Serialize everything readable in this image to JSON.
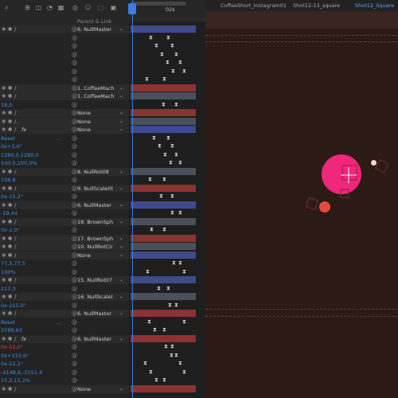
{
  "time_ruler": {
    "marker": "02s"
  },
  "column_header": {
    "parent_link": "Parent & Link"
  },
  "composition_tabs": [
    {
      "label": "CoffeeShort_Instagram01"
    },
    {
      "label": "Shot12-13_square"
    },
    {
      "label": "Shot12_Square"
    }
  ],
  "rows": [
    {
      "kind": "layer",
      "name": "6. NullMaster",
      "dd": "⌄"
    },
    {
      "kind": "spiral"
    },
    {
      "kind": "spiral"
    },
    {
      "kind": "spiral"
    },
    {
      "kind": "spiral"
    },
    {
      "kind": "spiral"
    },
    {
      "kind": "spiral"
    },
    {
      "kind": "layer",
      "name": "1. CoffeeMach",
      "dd": "⌄"
    },
    {
      "kind": "layer",
      "name": "1. CoffeeMach",
      "dd": "⌄"
    },
    {
      "kind": "value",
      "value": "18,0"
    },
    {
      "kind": "layer",
      "name": "None",
      "dd": "⌄"
    },
    {
      "kind": "layer",
      "name": "None",
      "dd": "⌄"
    },
    {
      "kind": "layer-fx",
      "name": "None",
      "dd": "⌄"
    },
    {
      "kind": "value",
      "value": "Reset",
      "dots": "..."
    },
    {
      "kind": "value",
      "value": "0x+3,6°"
    },
    {
      "kind": "value",
      "value": "1280,0,1280,0"
    },
    {
      "kind": "value",
      "value": "100,0,100,0%"
    },
    {
      "kind": "layer",
      "name": "8. NullRot08",
      "dd": "⌄"
    },
    {
      "kind": "value",
      "value": "338,8"
    },
    {
      "kind": "layer",
      "name": "9. NullScale0t",
      "dd": "⌄"
    },
    {
      "kind": "value",
      "value": "0x-15,2°"
    },
    {
      "kind": "layer",
      "name": "6. NullMaster",
      "dd": "⌄"
    },
    {
      "kind": "value",
      "value": "-19,44"
    },
    {
      "kind": "layer",
      "name": "18. BrownSph",
      "dd": "⌄"
    },
    {
      "kind": "value",
      "value": "0x-2,0°"
    },
    {
      "kind": "layer",
      "name": "17. BrownSph",
      "dd": "⌄"
    },
    {
      "kind": "layer",
      "name": "10. NullRotCir",
      "dd": "⌄"
    },
    {
      "kind": "layer",
      "name": "None",
      "dd": "⌄"
    },
    {
      "kind": "value",
      "value": "77,5,77,5"
    },
    {
      "kind": "value",
      "value": "100%"
    },
    {
      "kind": "layer",
      "name": "15. NullRot07",
      "dd": "⌄"
    },
    {
      "kind": "value",
      "value": "217,3"
    },
    {
      "kind": "layer",
      "name": "16. NullScale(",
      "dd": "⌄"
    },
    {
      "kind": "value",
      "value": "0x-215,0°"
    },
    {
      "kind": "layer",
      "name": "6. NullMaster",
      "dd": "⌄"
    },
    {
      "kind": "value",
      "value": "Reset",
      "dots": "..."
    },
    {
      "kind": "value",
      "value": "3788,83"
    },
    {
      "kind": "layer-fx",
      "name": "6. NullMaster",
      "dd": "⌄"
    },
    {
      "kind": "value",
      "value": "0x-52,0°",
      "red": true
    },
    {
      "kind": "value",
      "value": "0x+333,6°"
    },
    {
      "kind": "value",
      "value": "0x-12,1°"
    },
    {
      "kind": "value",
      "value": "-4148,6,-2151,4"
    },
    {
      "kind": "value",
      "value": "15,2,15,2%"
    },
    {
      "kind": "layer",
      "name": "None",
      "dd": "⌄"
    }
  ],
  "colors": {
    "accent": "#3b7de0",
    "comp_bg": "#2c1a16",
    "pink": "#f0277a",
    "red_ball": "#e24a3d"
  }
}
